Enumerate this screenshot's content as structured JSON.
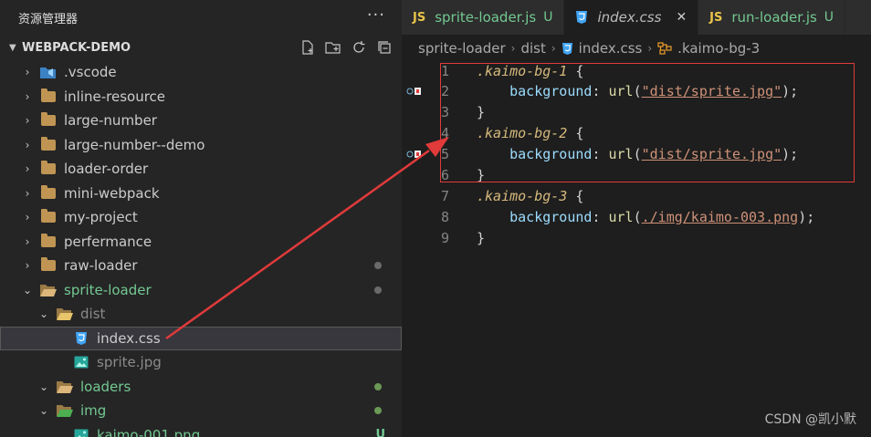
{
  "sidebar": {
    "title": "资源管理器",
    "more": "···",
    "project": "WEBPACK-DEMO",
    "items": [
      {
        "label": ".vscode",
        "type": "folder",
        "depth": 0,
        "twisty": "›",
        "style": "normal"
      },
      {
        "label": "inline-resource",
        "type": "folder",
        "depth": 0,
        "twisty": "›",
        "style": "normal"
      },
      {
        "label": "large-number",
        "type": "folder",
        "depth": 0,
        "twisty": "›",
        "style": "normal"
      },
      {
        "label": "large-number--demo",
        "type": "folder",
        "depth": 0,
        "twisty": "›",
        "style": "normal"
      },
      {
        "label": "loader-order",
        "type": "folder",
        "depth": 0,
        "twisty": "›",
        "style": "normal"
      },
      {
        "label": "mini-webpack",
        "type": "folder",
        "depth": 0,
        "twisty": "›",
        "style": "normal"
      },
      {
        "label": "my-project",
        "type": "folder",
        "depth": 0,
        "twisty": "›",
        "style": "normal"
      },
      {
        "label": "perfermance",
        "type": "folder",
        "depth": 0,
        "twisty": "›",
        "style": "normal"
      },
      {
        "label": "raw-loader",
        "type": "folder",
        "depth": 0,
        "twisty": "›",
        "style": "normal"
      },
      {
        "label": "sprite-loader",
        "type": "folder-open",
        "depth": 0,
        "twisty": "⌄",
        "style": "green"
      },
      {
        "label": "dist",
        "type": "folder-open",
        "depth": 1,
        "twisty": "⌄",
        "style": "dim"
      },
      {
        "label": "index.css",
        "type": "css",
        "depth": 2,
        "twisty": "",
        "style": "selected"
      },
      {
        "label": "sprite.jpg",
        "type": "image",
        "depth": 2,
        "twisty": "",
        "style": "dim"
      },
      {
        "label": "loaders",
        "type": "folder-open",
        "depth": 1,
        "twisty": "⌄",
        "style": "green"
      },
      {
        "label": "img",
        "type": "folder-open",
        "depth": 1,
        "twisty": "⌄",
        "style": "green"
      },
      {
        "label": "kaimo-001.png",
        "type": "image",
        "depth": 2,
        "twisty": "",
        "style": "green"
      }
    ],
    "git_badge": "U"
  },
  "tabs": [
    {
      "icon": "JS",
      "label": "sprite-loader.js",
      "status": "U",
      "active": false
    },
    {
      "icon": "css",
      "label": "index.css",
      "status": "",
      "active": true,
      "close": "✕"
    },
    {
      "icon": "JS",
      "label": "run-loader.js",
      "status": "U",
      "active": false
    }
  ],
  "breadcrumb": [
    "sprite-loader",
    "dist",
    "index.css",
    ".kaimo-bg-3"
  ],
  "code": {
    "lines": [
      {
        "n": "1",
        "selector": ".kaimo-bg-1",
        "brace": " {"
      },
      {
        "n": "2",
        "indent": "    ",
        "prop": "background",
        "colon": ": ",
        "fn": "url",
        "open": "(",
        "str": "\"dist/sprite.jpg\"",
        "close": ");"
      },
      {
        "n": "3",
        "brace": "}"
      },
      {
        "n": "4",
        "selector": ".kaimo-bg-2",
        "brace": " {"
      },
      {
        "n": "5",
        "indent": "    ",
        "prop": "background",
        "colon": ": ",
        "fn": "url",
        "open": "(",
        "str": "\"dist/sprite.jpg\"",
        "close": ");"
      },
      {
        "n": "6",
        "brace": "}"
      },
      {
        "n": "7",
        "selector": ".kaimo-bg-3",
        "brace": " {"
      },
      {
        "n": "8",
        "indent": "    ",
        "prop": "background",
        "colon": ": ",
        "fn": "url",
        "open": "(",
        "str": "./img/kaimo-003.png",
        "close": ");"
      },
      {
        "n": "9",
        "brace": "}"
      }
    ]
  },
  "colors": {
    "annotation": "#e03a3a",
    "git_untracked": "#73c991",
    "folder": "#c09553"
  },
  "watermark": "CSDN @凯小默"
}
